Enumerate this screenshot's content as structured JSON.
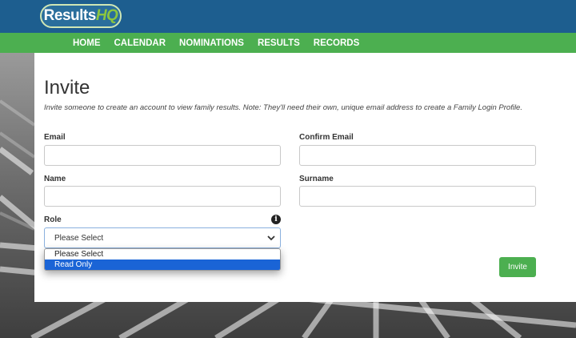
{
  "brand": {
    "logo_text_main": "Results",
    "logo_text_accent": "HQ",
    "accent_color": "#8cc63f",
    "topbar_color": "#1d5e8f",
    "navbar_color": "#4caf50"
  },
  "nav": {
    "items": [
      "HOME",
      "CALENDAR",
      "NOMINATIONS",
      "RESULTS",
      "RECORDS"
    ]
  },
  "form": {
    "title": "Invite",
    "description": "Invite someone to create an account to view family results. Note: They'll need their own, unique email address to create a Family Login Profile.",
    "email_label": "Email",
    "email_value": "",
    "confirm_email_label": "Confirm Email",
    "confirm_email_value": "",
    "name_label": "Name",
    "name_value": "",
    "surname_label": "Surname",
    "surname_value": "",
    "role_label": "Role",
    "role_selected": "Please Select",
    "role_options": [
      "Please Select",
      "Read Only"
    ],
    "role_highlighted_option": "Read Only",
    "info_icon": "info-circle-icon",
    "submit_label": "Invite"
  }
}
